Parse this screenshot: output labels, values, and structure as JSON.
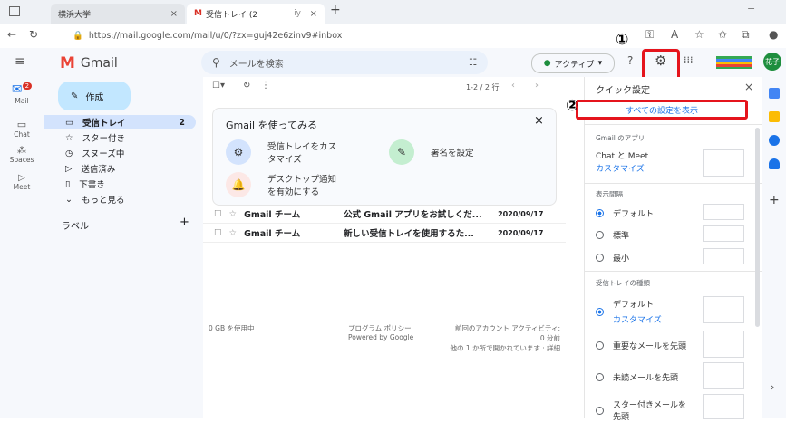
{
  "browser": {
    "tab1_title": "横浜大学",
    "tab2_title": "受信トレイ (2",
    "tab2_user": "iy",
    "url": "https://mail.google.com/mail/u/0/?zx=guj42e6zinv9#inbox"
  },
  "header": {
    "app_name": "Gmail",
    "search_placeholder": "メールを検索",
    "status_label": "アクティブ",
    "avatar_label": "花子"
  },
  "rail": {
    "mail": "Mail",
    "chat": "Chat",
    "spaces": "Spaces",
    "meet": "Meet",
    "mail_badge": "2"
  },
  "nav": {
    "compose": "作成",
    "items": [
      {
        "label": "受信トレイ",
        "count": "2",
        "icon": "inbox-icon"
      },
      {
        "label": "スター付き",
        "count": "",
        "icon": "star-icon"
      },
      {
        "label": "スヌーズ中",
        "count": "",
        "icon": "clock-icon"
      },
      {
        "label": "送信済み",
        "count": "",
        "icon": "send-icon"
      },
      {
        "label": "下書き",
        "count": "",
        "icon": "draft-icon"
      },
      {
        "label": "もっと見る",
        "count": "",
        "icon": "chevron-down-icon"
      }
    ],
    "labels_heading": "ラベル",
    "add_label": "+"
  },
  "main": {
    "pagination": "1-2 / 2 行",
    "promo_title": "Gmail を使ってみる",
    "promo": {
      "customize_inbox": "受信トレイをカス\nタマイズ",
      "signature": "署名を設定",
      "desktop_notify": "デスクトップ通知\nを有効にする"
    },
    "emails": [
      {
        "sender": "Gmail チーム",
        "subject": "公式 Gmail アプリをお試しくだ...",
        "date": "2020/09/17"
      },
      {
        "sender": "Gmail チーム",
        "subject": "新しい受信トレイを使用するた...",
        "date": "2020/09/17"
      }
    ],
    "footer": {
      "storage": "0 GB を使用中",
      "policy": "プログラム ポリシー",
      "powered": "Powered by Google",
      "activity_line1": "前回のアカウント アクティビティ:",
      "activity_line2": "0 分前",
      "activity_line3": "他の 1 か所で開かれています · 詳細"
    }
  },
  "quick_settings": {
    "title": "クイック設定",
    "all_settings": "すべての設定を表示",
    "apps_heading": "Gmail のアプリ",
    "chat_meet": "Chat と Meet",
    "customize": "カスタマイズ",
    "density_heading": "表示間隔",
    "density": [
      "デフォルト",
      "標準",
      "最小"
    ],
    "inbox_type_heading": "受信トレイの種類",
    "inbox_types": [
      "デフォルト",
      "重要なメールを先頭",
      "未読メールを先頭",
      "スター付きメールを\n先頭"
    ],
    "inbox_customize": "カスタマイズ"
  },
  "callouts": {
    "one": "①",
    "two": "②"
  },
  "colors": {
    "accent": "#1a73e8",
    "highlight": "#e5141c",
    "compose": "#c2e7ff"
  }
}
